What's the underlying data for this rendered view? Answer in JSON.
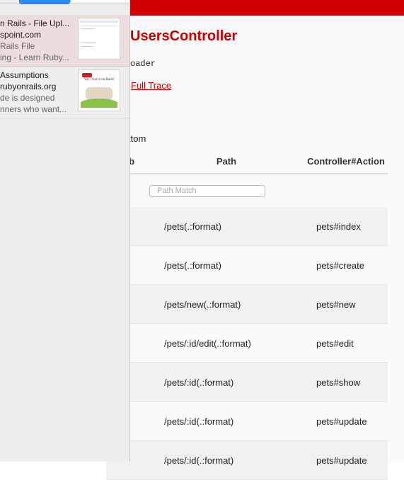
{
  "error_page": {
    "title": "UsersController",
    "file_line": "oader",
    "full_trace_link": "Full Trace",
    "routes_intro": "ttom",
    "table": {
      "headers": {
        "verb": "erb",
        "path": "Path",
        "controller": "Controller#Action"
      },
      "search_placeholder": "Path Match",
      "rows": [
        {
          "path": "/pets(.:format)",
          "action": "pets#index"
        },
        {
          "path": "/pets(.:format)",
          "action": "pets#create"
        },
        {
          "path": "/pets/new(.:format)",
          "action": "pets#new"
        },
        {
          "path": "/pets/:id/edit(.:format)",
          "action": "pets#edit"
        },
        {
          "path": "/pets/:id(.:format)",
          "action": "pets#show"
        },
        {
          "path": "/pets/:id(.:format)",
          "action": "pets#update"
        },
        {
          "path": "/pets/:id(.:format)",
          "action": "pets#update"
        }
      ]
    }
  },
  "history_overlay": {
    "entries": [
      {
        "title": "n Rails - File Upl...",
        "domain": "spoint.com",
        "snippet_1": "Rails File",
        "snippet_2": "ing - Learn Ruby..."
      },
      {
        "title": "Assumptions",
        "domain": "rubyonrails.org",
        "snippet_1": "de is designed",
        "snippet_2": "nners who want..."
      }
    ],
    "thumb_caption": "Yay! You're on Rails!"
  },
  "colors": {
    "accent_red": "#d10000",
    "title_red": "#c80000",
    "selected_segment_blue": "#2d88f3"
  }
}
